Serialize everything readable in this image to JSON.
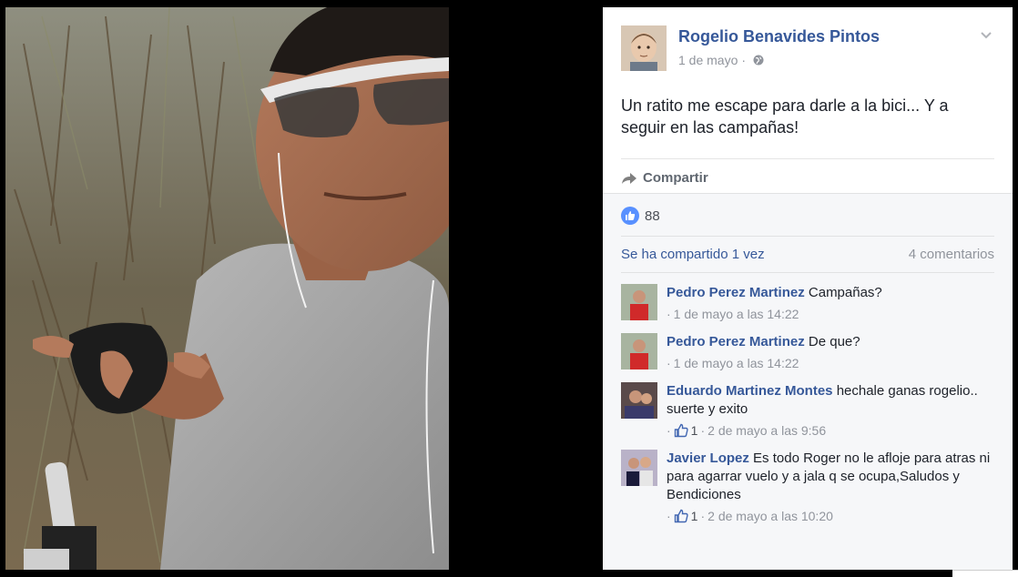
{
  "post": {
    "author": "Rogelio Benavides Pintos",
    "date": "1 de mayo",
    "date_separator": "·",
    "text": "Un ratito me escape para darle a la bici... Y a seguir en las campañas!",
    "share_label": "Compartir"
  },
  "feedback": {
    "like_count": "88",
    "shares_text": "Se ha compartido 1 vez",
    "comments_text": "4 comentarios"
  },
  "comments": [
    {
      "author": "Pedro Perez Martinez",
      "text": "Campañas?",
      "likes": "",
      "time": "1 de mayo a las 14:22"
    },
    {
      "author": "Pedro Perez Martinez",
      "text": "De que?",
      "likes": "",
      "time": "1 de mayo a las 14:22"
    },
    {
      "author": "Eduardo Martinez Montes",
      "text": "hechale ganas rogelio.. suerte y exito",
      "likes": "1",
      "time": "2 de mayo a las 9:56"
    },
    {
      "author": "Javier Lopez",
      "text": "Es todo Roger no le afloje para atras ni para agarrar vuelo y a jala q se ocupa,Saludos y Bendiciones",
      "likes": "1",
      "time": "2 de mayo a las 10:20"
    }
  ],
  "icons": {
    "globe": "globe-icon",
    "chevron": "chevron-down-icon",
    "share": "share-arrow-icon",
    "like": "thumbs-up-icon"
  },
  "colors": {
    "link": "#365899",
    "like_blue": "#5890ff",
    "muted": "#90949c",
    "feedback_bg": "#f6f7f9"
  }
}
